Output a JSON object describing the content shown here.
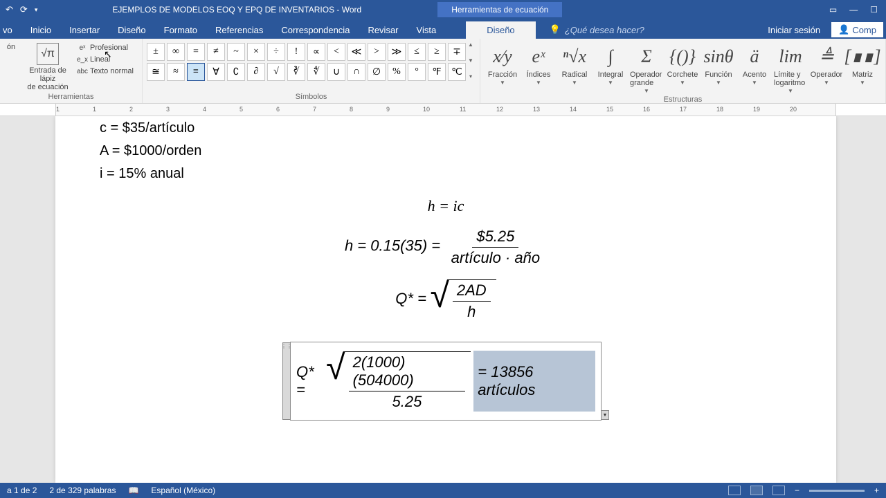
{
  "titlebar": {
    "doc_title": "EJEMPLOS DE MODELOS EOQ Y EPQ DE INVENTARIOS - Word",
    "equation_tools": "Herramientas de ecuación"
  },
  "tabs": {
    "inicio": "Inicio",
    "insertar": "Insertar",
    "diseno1": "Diseño",
    "formato": "Formato",
    "referencias": "Referencias",
    "correspondencia": "Correspondencia",
    "revisar": "Revisar",
    "vista": "Vista",
    "diseno2": "Diseño",
    "tell_me": "¿Qué desea hacer?",
    "signin": "Iniciar sesión",
    "share": "Comp"
  },
  "ribbon": {
    "tools": {
      "ecuacion": {
        "line1": "ón",
        "label": "Ecuación"
      },
      "entrada": {
        "line1": "Entrada de lápiz",
        "line2": "de ecuación"
      },
      "profesional": "Profesional",
      "lineal": "Lineal",
      "texto_normal": "Texto normal",
      "group_label": "Herramientas"
    },
    "symbols": {
      "row1": [
        "±",
        "∞",
        "=",
        "≠",
        "~",
        "×",
        "÷",
        "!",
        "∝",
        "<",
        "≪",
        ">",
        "≫",
        "≤",
        "≥",
        "∓"
      ],
      "row2": [
        "≅",
        "≈",
        "≡",
        "∀",
        "∁",
        "∂",
        "√",
        "∛",
        "∜",
        "∪",
        "∩",
        "∅",
        "%",
        "°",
        "℉",
        "℃"
      ],
      "group_label": "Símbolos"
    },
    "structures": {
      "items": [
        {
          "glyph": "x⁄y",
          "label": "Fracción"
        },
        {
          "glyph": "eˣ",
          "label": "Índices"
        },
        {
          "glyph": "ⁿ√x",
          "label": "Radical"
        },
        {
          "glyph": "∫",
          "label": "Integral"
        },
        {
          "glyph": "Σ",
          "label": "Operador grande ▾"
        },
        {
          "glyph": "{()}",
          "label": "Corchete"
        },
        {
          "glyph": "sinθ",
          "label": "Función"
        },
        {
          "glyph": "ä",
          "label": "Acento"
        },
        {
          "glyph": "lim",
          "label": "Límite y logaritmo ▾"
        },
        {
          "glyph": "≜",
          "label": "Operador"
        },
        {
          "glyph": "[∎∎]",
          "label": "Matriz"
        }
      ],
      "group_label": "Estructuras"
    }
  },
  "document": {
    "line1": "c = $35/artículo",
    "line2": "A = $1000/orden",
    "line3": "i = 15% anual",
    "eq1": "h = ic",
    "eq2": {
      "lhs": "h = 0.15(35) =",
      "num": "$5.25",
      "den": "artículo · año"
    },
    "eq3": {
      "lhs": "Q* =",
      "num": "2AD",
      "den": "h"
    },
    "eq4": {
      "lhs": "Q* =",
      "num": "2(1000)(504000)",
      "den": "5.25",
      "rhs_eq": "=",
      "rhs_val": "13856 artículos"
    }
  },
  "statusbar": {
    "page": "a 1 de 2",
    "words": "2 de 329 palabras",
    "lang": "Español (México)",
    "zoom_minus": "−",
    "zoom_plus": "+"
  },
  "ruler_marks": [
    "1",
    "1",
    "2",
    "3",
    "4",
    "5",
    "6",
    "7",
    "8",
    "9",
    "10",
    "11",
    "12",
    "13",
    "14",
    "15",
    "16",
    "17",
    "18",
    "19",
    "20"
  ]
}
